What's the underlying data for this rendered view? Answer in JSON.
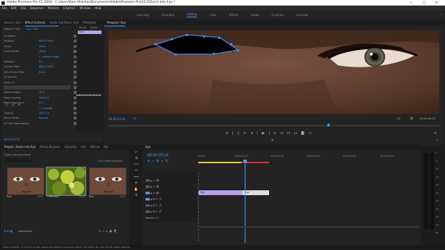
{
  "window": {
    "title": "Adobe Premiere Pro CC 2018 - C:\\Users\\Ravi Shankar\\Documents\\Adobe\\Premiere Pro\\12.0\\Zoom into Eye *",
    "buttons": [
      "—",
      "□",
      "✕"
    ]
  },
  "menu": [
    "File",
    "Edit",
    "Clip",
    "Sequence",
    "Markers",
    "Graphics",
    "Window",
    "Help"
  ],
  "workspaces": {
    "items": [
      "Learning",
      "Assembly",
      "Editing",
      "Color",
      "Effects",
      "Audio",
      "Graphics",
      "Libraries"
    ],
    "active": "Editing",
    "more": "»"
  },
  "effect_controls": {
    "tabs": [
      "Source: Eye",
      "Effect Controls",
      "Audio Clip Mixer: Eye",
      "Metadata"
    ],
    "active_tab": "Effect Controls",
    "master_label": "Master * Eye",
    "clip_label": "Eye * Eye",
    "clip_block": "Eye",
    "timecode_left": "00:00",
    "timecode_right": "00:00:",
    "section": "Video Effects",
    "rows": [
      {
        "name": "fx Motion",
        "value": ""
      },
      {
        "name": "Position",
        "value": "960.0   540.0"
      },
      {
        "name": "Scale",
        "value": "100.0"
      },
      {
        "name": "Scale Width",
        "value": "100.0"
      },
      {
        "name": "",
        "value": "✓ Uniform Scale"
      },
      {
        "name": "Rotation",
        "value": "0.0"
      },
      {
        "name": "Anchor Point",
        "value": "960.0   540.0"
      },
      {
        "name": "Anti-flicker Filter",
        "value": "0.00"
      },
      {
        "name": "fx Opacity",
        "value": ""
      },
      {
        "name": "Mask (1)",
        "value": ""
      },
      {
        "name": "Mask Path",
        "value": ""
      },
      {
        "name": "Mask Feather",
        "value": "10.0"
      },
      {
        "name": "Mask Opacity",
        "value": "100.0 %"
      },
      {
        "name": "Mask Expansion",
        "value": "0.0"
      },
      {
        "name": "",
        "value": "✓ Inverted"
      },
      {
        "name": "Opacity",
        "value": "100.0 %"
      },
      {
        "name": "Blend Mode",
        "value": "Normal"
      },
      {
        "name": "fx Time Remapping",
        "value": ""
      }
    ],
    "footer_time": "00:00:03:10"
  },
  "program": {
    "title": "Program: Eye",
    "timecode": "00:00:03:10",
    "fit": "Fit",
    "fit_options": "50%",
    "quality": "1/4",
    "duration": "00:00:05:03"
  },
  "project": {
    "tabs": [
      "Project: Zoom into Eye",
      "Media Browser",
      "Libraries",
      "Info",
      "Effects",
      "Ma"
    ],
    "active_tab": "Project: Zoom into Eye",
    "file": "Zoom into Eye.prproj",
    "count": "1 of 3 items selected",
    "search_placeholder": "",
    "items": [
      {
        "name": "Eye",
        "duration": "4:29"
      },
      {
        "name": "Greenery",
        "duration": "4:24"
      },
      {
        "name": "Eye",
        "duration": "5:03"
      }
    ]
  },
  "timeline": {
    "title": "Eye",
    "timecode": "00:00:03:10",
    "ruler": [
      "00:00",
      "00:00:01:00",
      "00:00:02:00",
      "00:00:03:00",
      "00:00:04:00",
      "00:00:05:00"
    ],
    "video_tracks": [
      "V3",
      "V2",
      "V1"
    ],
    "audio_tracks": [
      "A1",
      "A2",
      "A3"
    ],
    "master_label": "Master",
    "master_value": "0.0",
    "clips": [
      {
        "name": "Eye",
        "color": "#b9a0e8"
      },
      {
        "name": "Eye",
        "color": "#dedede"
      }
    ]
  },
  "meter_scale": [
    "0",
    "-6",
    "-12",
    "-18",
    "-24",
    "-30",
    "-36",
    "-42",
    "-48",
    "-54",
    "dB"
  ],
  "status": "Click to select, or click in empty space and drag to marquee select. Use Shift, Alt, and Ctrl for other options.",
  "colors": {
    "accent": "#3da0ff",
    "clip_purple": "#b9a0e8",
    "playhead": "#3da0ff"
  }
}
